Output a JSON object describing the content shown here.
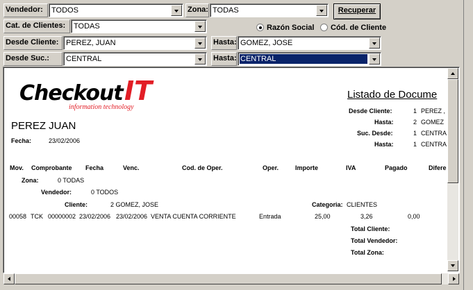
{
  "filters": {
    "vendedor": {
      "label": "Vendedor:",
      "value": "TODOS"
    },
    "zona": {
      "label": "Zona:",
      "value": "TODAS"
    },
    "categoria": {
      "label": "Cat. de Clientes:",
      "value": "TODAS"
    },
    "desde_cliente": {
      "label": "Desde Cliente:",
      "value": "PEREZ, JUAN"
    },
    "hasta_cliente": {
      "label": "Hasta:",
      "value": "GOMEZ, JOSE"
    },
    "desde_suc": {
      "label": "Desde Suc.:",
      "value": "CENTRAL"
    },
    "hasta_suc": {
      "label": "Hasta:",
      "value": "CENTRAL"
    }
  },
  "recuperar_label": "Recuperar",
  "order": {
    "razon_social": {
      "label": "Razón Social",
      "selected": true
    },
    "cod_cliente": {
      "label": "Cód. de Cliente",
      "selected": false
    }
  },
  "report": {
    "logo_main": "Checkout",
    "logo_it": "IT",
    "logo_tagline": "information technology",
    "title": "Listado de Docume",
    "client_name": "PEREZ JUAN",
    "fecha_label": "Fecha:",
    "fecha_value": "23/02/2006",
    "params": [
      {
        "label": "Desde Cliente:",
        "num": "1",
        "value": "PEREZ ,"
      },
      {
        "label": "Hasta:",
        "num": "2",
        "value": "GOMEZ"
      },
      {
        "label": "Suc. Desde:",
        "num": "1",
        "value": "CENTRA"
      },
      {
        "label": "Hasta:",
        "num": "1",
        "value": "CENTRA"
      }
    ],
    "columns": [
      "Mov.",
      "Comprobante",
      "Fecha",
      "Venc.",
      "Cod. de Oper.",
      "Oper.",
      "Importe",
      "IVA",
      "Pagado",
      "Difere"
    ],
    "zona_label": "Zona:",
    "zona_value": "0 TODAS",
    "vendedor_label": "Vendedor:",
    "vendedor_value": "0 TODOS",
    "cliente_label": "Cliente:",
    "cliente_value": "2 GOMEZ, JOSE",
    "categoria_label": "Categoria:",
    "categoria_value": "CLIENTES",
    "row": {
      "mov": "00058",
      "tipo": "TCK",
      "comprobante": "00000002",
      "fecha": "23/02/2006",
      "venc": "23/02/2006",
      "cod_oper": "VENTA CUENTA CORRIENTE",
      "oper": "Entrada",
      "importe": "25,00",
      "iva": "3,26",
      "pagado": "0,00"
    },
    "totals": [
      "Total Cliente:",
      "Total Vendedor:",
      "Total Zona:"
    ]
  }
}
